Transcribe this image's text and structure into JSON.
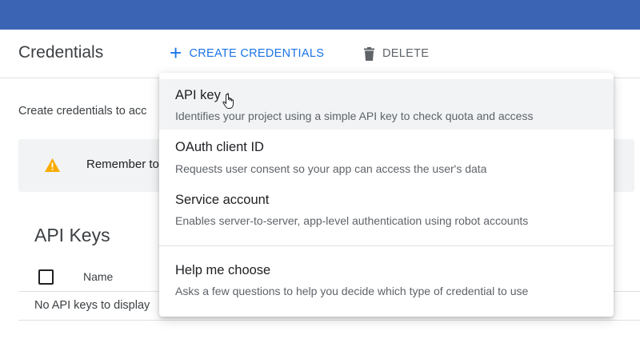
{
  "header": {
    "title": "Credentials",
    "create_label": "CREATE CREDENTIALS",
    "delete_label": "DELETE"
  },
  "main": {
    "intro_text": "Create credentials to acc",
    "notice_text": "Remember to",
    "section_title": "API Keys",
    "table": {
      "columns": [
        "Name"
      ],
      "empty_text": "No API keys to display"
    }
  },
  "menu": {
    "items": [
      {
        "title": "API key",
        "description": "Identifies your project using a simple API key to check quota and access"
      },
      {
        "title": "OAuth client ID",
        "description": "Requests user consent so your app can access the user's data"
      },
      {
        "title": "Service account",
        "description": "Enables server-to-server, app-level authentication using robot accounts"
      },
      {
        "title": "Help me choose",
        "description": "Asks a few questions to help you decide which type of credential to use"
      }
    ]
  },
  "colors": {
    "topbar": "#3c64b4",
    "accent": "#1a73e8",
    "warning": "#f9ab00",
    "notice_background": "#f1f3f4"
  },
  "icons": [
    "plus-icon",
    "trash-icon",
    "warning-icon",
    "hand-cursor-icon"
  ]
}
